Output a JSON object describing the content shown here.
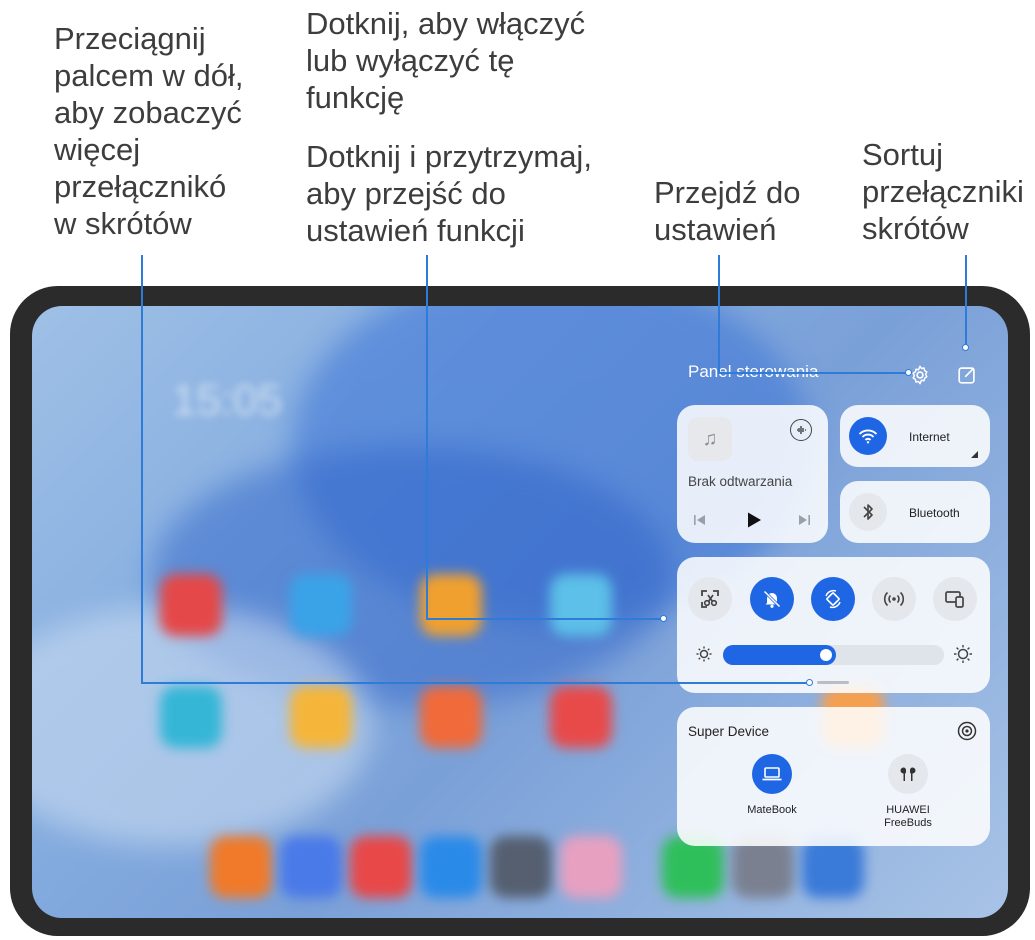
{
  "callouts": {
    "swipe": "Przeciągnij\npalcem w dół,\naby zobaczyć\nwięcej\nprzełącznikó\nw skrótów",
    "tap": "Dotknij, aby włączyć\nlub wyłączyć tę\nfunkcję",
    "hold": "Dotknij i przytrzymaj,\naby przejść do\nustawień funkcji",
    "settings": "Przejdź do\nustawień",
    "sort": "Sortuj\nprzełączniki\nskrótów"
  },
  "panel": {
    "title": "Panel sterowania",
    "media": {
      "status": "Brak odtwarzania"
    },
    "internet": "Internet",
    "bluetooth": "Bluetooth",
    "super_device": {
      "title": "Super Device",
      "devices": [
        {
          "name": "MateBook"
        },
        {
          "name": "HUAWEI\nFreeBuds"
        }
      ]
    },
    "brightness_level": 0.51
  },
  "colors": {
    "accent": "#1f66e5",
    "leader": "#2f7bd8"
  },
  "icons": [
    "music-note-icon",
    "audio-output-icon",
    "prev-track-icon",
    "play-icon",
    "next-track-icon",
    "wifi-icon",
    "bluetooth-icon",
    "screenshot-icon",
    "silent-icon",
    "auto-rotate-icon",
    "hotspot-icon",
    "multi-screen-icon",
    "brightness-low-icon",
    "brightness-high-icon",
    "gear-icon",
    "edit-icon",
    "device-discover-icon",
    "laptop-icon",
    "earbuds-icon"
  ]
}
